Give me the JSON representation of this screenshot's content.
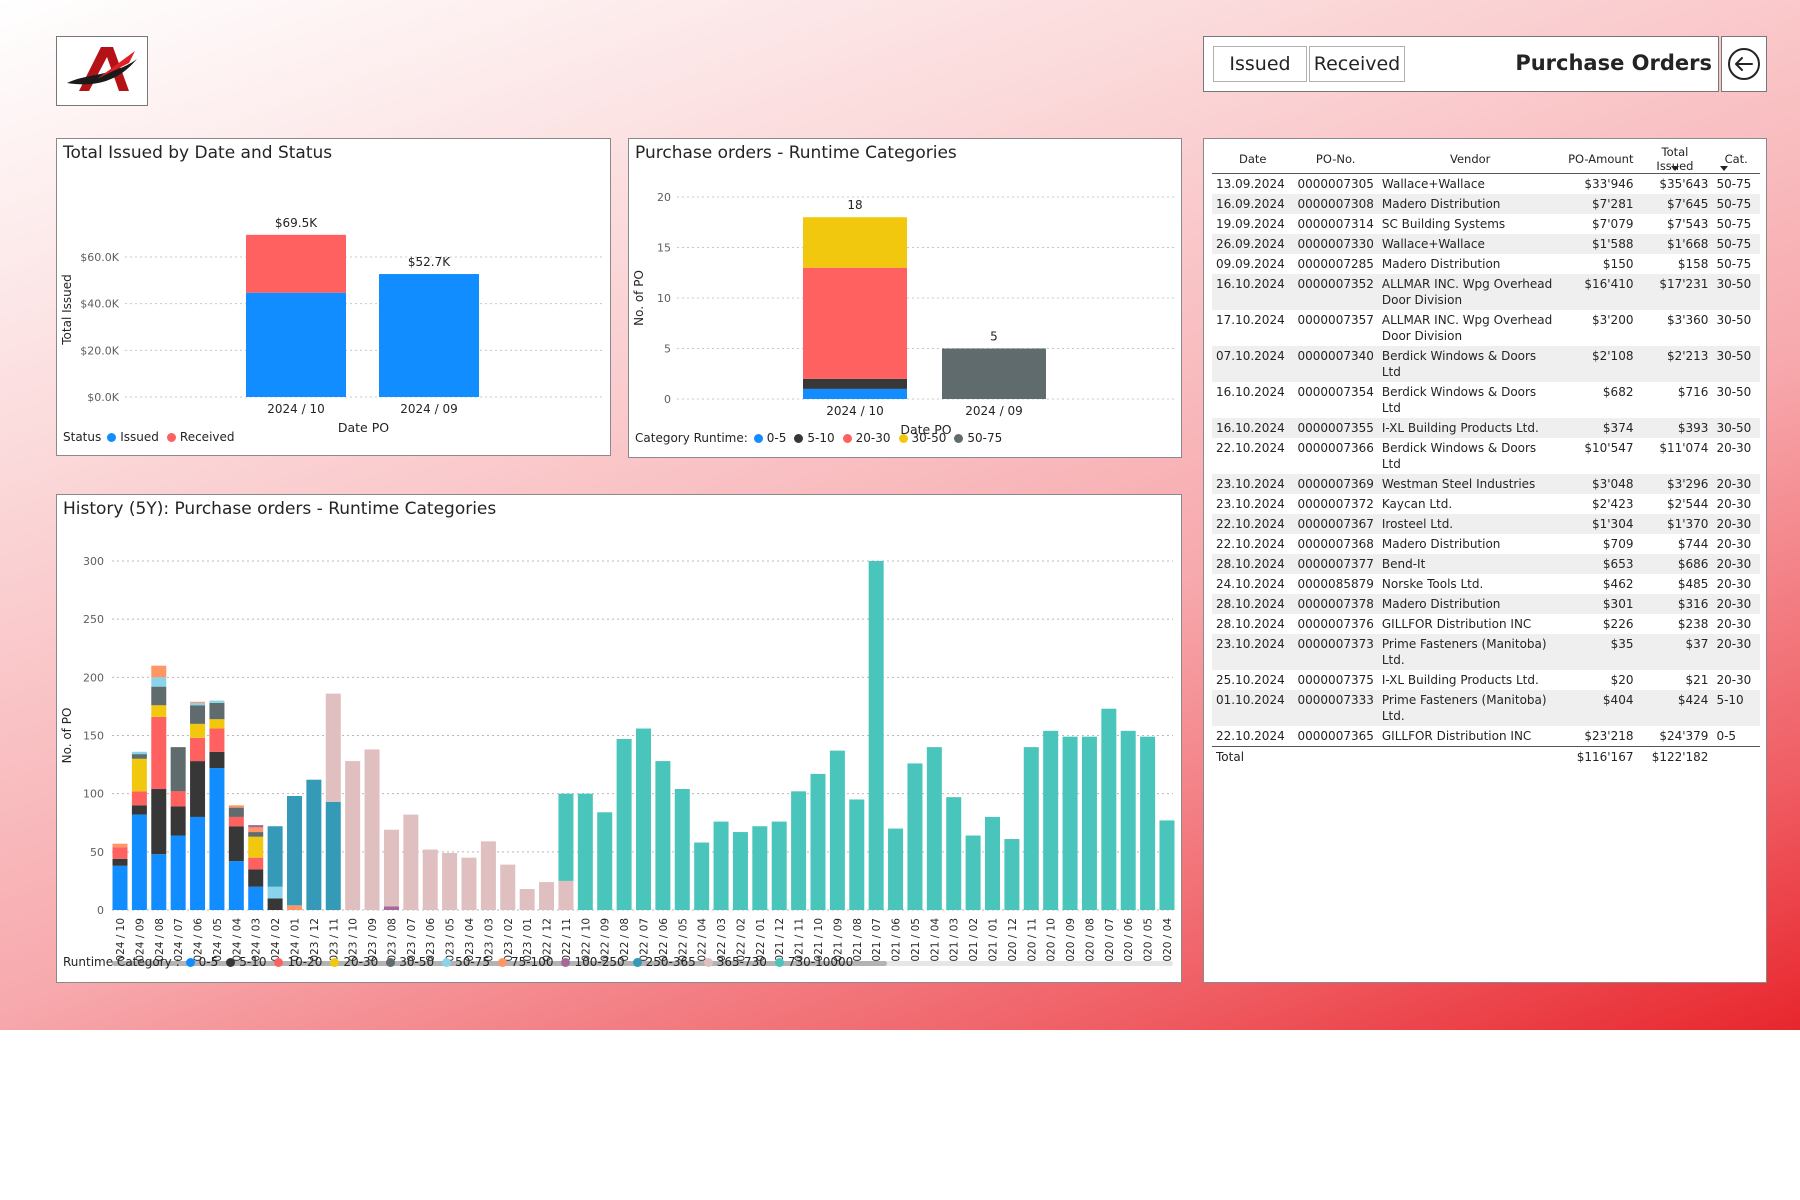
{
  "header": {
    "title": "Purchase Orders",
    "toggle_issued": "Issued",
    "toggle_received": "Received"
  },
  "chart_data": [
    {
      "id": "total-issued",
      "type": "bar",
      "title": "Total Issued by Date and Status",
      "xlabel": "Date PO",
      "ylabel": "Total Issued",
      "categories": [
        "2024 / 10",
        "2024 / 09"
      ],
      "yticks": [
        "$0.0K",
        "$20.0K",
        "$40.0K",
        "$60.0K"
      ],
      "ylim": [
        0,
        75000
      ],
      "series": [
        {
          "name": "Issued",
          "color": "#118DFF",
          "values": [
            44700,
            52700
          ]
        },
        {
          "name": "Received",
          "color": "#FF6060",
          "values": [
            24800,
            0
          ]
        }
      ],
      "totals": [
        "$69.5K",
        "$52.7K"
      ],
      "legend_title": "Status",
      "legend_position": "bottom-left"
    },
    {
      "id": "runtime-categories",
      "type": "bar",
      "title": "Purchase orders - Runtime Categories",
      "xlabel": "Date PO",
      "ylabel": "No. of PO",
      "categories": [
        "2024 / 10",
        "2024 / 09"
      ],
      "yticks": [
        0,
        5,
        10,
        15,
        20
      ],
      "ylim": [
        0,
        20
      ],
      "series": [
        {
          "name": "0-5",
          "color": "#118DFF",
          "values": [
            1,
            0
          ]
        },
        {
          "name": "5-10",
          "color": "#373737",
          "values": [
            1,
            0
          ]
        },
        {
          "name": "20-30",
          "color": "#FF6060",
          "values": [
            11,
            0
          ]
        },
        {
          "name": "30-50",
          "color": "#F2C80F",
          "values": [
            5,
            0
          ]
        },
        {
          "name": "50-75",
          "color": "#5F6B6D",
          "values": [
            0,
            5
          ]
        }
      ],
      "totals": [
        "18",
        "5"
      ],
      "legend_title": "Category Runtime:",
      "legend_position": "bottom-left"
    },
    {
      "id": "history",
      "type": "bar",
      "title": "History (5Y): Purchase orders - Runtime Categories",
      "ylabel": "No. of PO",
      "yticks": [
        0,
        50,
        100,
        150,
        200,
        250,
        300
      ],
      "ylim": [
        0,
        300
      ],
      "grid": true,
      "categories": [
        "2024 / 10",
        "2024 / 09",
        "2024 / 08",
        "2024 / 07",
        "2024 / 06",
        "2024 / 05",
        "2024 / 04",
        "2024 / 03",
        "2024 / 02",
        "2024 / 01",
        "2023 / 12",
        "2023 / 11",
        "2023 / 10",
        "2023 / 09",
        "2023 / 08",
        "2023 / 07",
        "2023 / 06",
        "2023 / 05",
        "2023 / 04",
        "2023 / 03",
        "2023 / 02",
        "2023 / 01",
        "2022 / 12",
        "2022 / 11",
        "2022 / 10",
        "2022 / 09",
        "2022 / 08",
        "2022 / 07",
        "2022 / 06",
        "2022 / 05",
        "2022 / 04",
        "2022 / 03",
        "2022 / 02",
        "2022 / 01",
        "2021 / 12",
        "2021 / 11",
        "2021 / 10",
        "2021 / 09",
        "2021 / 08",
        "2021 / 07",
        "2021 / 06",
        "2021 / 05",
        "2021 / 04",
        "2021 / 03",
        "2021 / 02",
        "2021 / 01",
        "2020 / 12",
        "2020 / 11",
        "2020 / 10",
        "2020 / 09",
        "2020 / 08",
        "2020 / 07",
        "2020 / 06",
        "2020 / 05",
        "2020 / 04"
      ],
      "series": [
        {
          "name": "0-5",
          "color": "#118DFF",
          "values": [
            38,
            82,
            48,
            64,
            80,
            122,
            42,
            20,
            0,
            0,
            0,
            0,
            0,
            0,
            0,
            0,
            0,
            0,
            0,
            0,
            0,
            0,
            0,
            0,
            0,
            0,
            0,
            0,
            0,
            0,
            0,
            0,
            0,
            0,
            0,
            0,
            0,
            0,
            0,
            0,
            0,
            0,
            0,
            0,
            0,
            0,
            0,
            0,
            0,
            0,
            0,
            0,
            0,
            0,
            0
          ]
        },
        {
          "name": "5-10",
          "color": "#373737",
          "values": [
            6,
            8,
            56,
            25,
            48,
            14,
            30,
            15,
            10,
            0,
            0,
            0,
            0,
            0,
            0,
            0,
            0,
            0,
            0,
            0,
            0,
            0,
            0,
            0,
            0,
            0,
            0,
            0,
            0,
            0,
            0,
            0,
            0,
            0,
            0,
            0,
            0,
            0,
            0,
            0,
            0,
            0,
            0,
            0,
            0,
            0,
            0,
            0,
            0,
            0,
            0,
            0,
            0,
            0,
            0
          ]
        },
        {
          "name": "10-20",
          "color": "#FF6060",
          "values": [
            10,
            12,
            62,
            13,
            20,
            20,
            8,
            10,
            0,
            0,
            0,
            0,
            0,
            0,
            0,
            0,
            0,
            0,
            0,
            0,
            0,
            0,
            0,
            0,
            0,
            0,
            0,
            0,
            0,
            0,
            0,
            0,
            0,
            0,
            0,
            0,
            0,
            0,
            0,
            0,
            0,
            0,
            0,
            0,
            0,
            0,
            0,
            0,
            0,
            0,
            0,
            0,
            0,
            0,
            0
          ]
        },
        {
          "name": "20-30",
          "color": "#F2C80F",
          "values": [
            0,
            28,
            10,
            0,
            12,
            8,
            0,
            18,
            0,
            0,
            0,
            0,
            0,
            0,
            0,
            0,
            0,
            0,
            0,
            0,
            0,
            0,
            0,
            0,
            0,
            0,
            0,
            0,
            0,
            0,
            0,
            0,
            0,
            0,
            0,
            0,
            0,
            0,
            0,
            0,
            0,
            0,
            0,
            0,
            0,
            0,
            0,
            0,
            0,
            0,
            0,
            0,
            0,
            0,
            0
          ]
        },
        {
          "name": "30-50",
          "color": "#5F6B6D",
          "values": [
            0,
            4,
            16,
            38,
            16,
            14,
            8,
            4,
            0,
            0,
            0,
            0,
            0,
            0,
            0,
            0,
            0,
            0,
            0,
            0,
            0,
            0,
            0,
            0,
            0,
            0,
            0,
            0,
            0,
            0,
            0,
            0,
            0,
            0,
            0,
            0,
            0,
            0,
            0,
            0,
            0,
            0,
            0,
            0,
            0,
            0,
            0,
            0,
            0,
            0,
            0,
            0,
            0,
            0,
            0
          ]
        },
        {
          "name": "50-75",
          "color": "#8AD4EB",
          "values": [
            0,
            2,
            8,
            0,
            2,
            2,
            0,
            0,
            10,
            0,
            0,
            0,
            0,
            0,
            0,
            0,
            0,
            0,
            0,
            0,
            0,
            0,
            0,
            0,
            0,
            0,
            0,
            0,
            0,
            0,
            0,
            0,
            0,
            0,
            0,
            0,
            0,
            0,
            0,
            0,
            0,
            0,
            0,
            0,
            0,
            0,
            0,
            0,
            0,
            0,
            0,
            0,
            0,
            0,
            0
          ]
        },
        {
          "name": "75-100",
          "color": "#FE9666",
          "values": [
            3,
            0,
            10,
            0,
            1,
            0,
            2,
            4,
            0,
            4,
            0,
            0,
            0,
            0,
            0,
            0,
            0,
            0,
            0,
            0,
            0,
            0,
            0,
            0,
            0,
            0,
            0,
            0,
            0,
            0,
            0,
            0,
            0,
            0,
            0,
            0,
            0,
            0,
            0,
            0,
            0,
            0,
            0,
            0,
            0,
            0,
            0,
            0,
            0,
            0,
            0,
            0,
            0,
            0,
            0
          ]
        },
        {
          "name": "100-250",
          "color": "#A66999",
          "values": [
            0,
            0,
            0,
            0,
            0,
            0,
            0,
            2,
            0,
            0,
            0,
            0,
            0,
            0,
            3,
            0,
            0,
            0,
            0,
            0,
            0,
            0,
            0,
            0,
            0,
            0,
            0,
            0,
            0,
            0,
            0,
            0,
            0,
            0,
            0,
            0,
            0,
            0,
            0,
            0,
            0,
            0,
            0,
            0,
            0,
            0,
            0,
            0,
            0,
            0,
            0,
            0,
            0,
            0,
            0
          ]
        },
        {
          "name": "250-365",
          "color": "#3599B8",
          "values": [
            0,
            0,
            0,
            0,
            0,
            0,
            0,
            0,
            52,
            94,
            112,
            93,
            0,
            0,
            0,
            0,
            0,
            0,
            0,
            0,
            0,
            0,
            0,
            0,
            0,
            0,
            0,
            0,
            0,
            0,
            0,
            0,
            0,
            0,
            0,
            0,
            0,
            0,
            0,
            0,
            0,
            0,
            0,
            0,
            0,
            0,
            0,
            0,
            0,
            0,
            0,
            0,
            0,
            0,
            0
          ]
        },
        {
          "name": "365-730",
          "color": "#DFBFBF",
          "values": [
            0,
            0,
            0,
            0,
            0,
            0,
            0,
            0,
            0,
            0,
            0,
            93,
            128,
            138,
            66,
            82,
            52,
            49,
            45,
            59,
            39,
            18,
            24,
            25,
            0,
            0,
            0,
            0,
            0,
            0,
            0,
            0,
            0,
            0,
            0,
            0,
            0,
            0,
            0,
            0,
            0,
            0,
            0,
            0,
            0,
            0,
            0,
            0,
            0,
            0,
            0,
            0,
            0,
            0,
            0
          ]
        },
        {
          "name": "730-10000",
          "color": "#4AC5BB",
          "values": [
            0,
            0,
            0,
            0,
            0,
            0,
            0,
            0,
            0,
            0,
            0,
            0,
            0,
            0,
            0,
            0,
            0,
            0,
            0,
            0,
            0,
            0,
            0,
            75,
            100,
            84,
            147,
            156,
            128,
            104,
            58,
            76,
            67,
            72,
            76,
            102,
            117,
            137,
            95,
            300,
            70,
            126,
            140,
            97,
            64,
            80,
            61,
            140,
            154,
            149,
            149,
            173,
            154,
            149,
            77
          ]
        }
      ],
      "legend_title": "Runtime Category :",
      "legend_position": "bottom-left"
    }
  ],
  "table": {
    "columns": [
      "Date",
      "PO-No.",
      "Vendor",
      "PO-Amount",
      "Total Issued",
      "Cat."
    ],
    "rows": [
      [
        "13.09.2024",
        "0000007305",
        "Wallace+Wallace",
        "$33'946",
        "$35'643",
        "50-75"
      ],
      [
        "16.09.2024",
        "0000007308",
        "Madero Distribution",
        "$7'281",
        "$7'645",
        "50-75"
      ],
      [
        "19.09.2024",
        "0000007314",
        "SC Building Systems",
        "$7'079",
        "$7'543",
        "50-75"
      ],
      [
        "26.09.2024",
        "0000007330",
        "Wallace+Wallace",
        "$1'588",
        "$1'668",
        "50-75"
      ],
      [
        "09.09.2024",
        "0000007285",
        "Madero Distribution",
        "$150",
        "$158",
        "50-75"
      ],
      [
        "16.10.2024",
        "0000007352",
        "ALLMAR INC. Wpg Overhead Door Division",
        "$16'410",
        "$17'231",
        "30-50"
      ],
      [
        "17.10.2024",
        "0000007357",
        "ALLMAR INC. Wpg Overhead Door Division",
        "$3'200",
        "$3'360",
        "30-50"
      ],
      [
        "07.10.2024",
        "0000007340",
        "Berdick Windows & Doors Ltd",
        "$2'108",
        "$2'213",
        "30-50"
      ],
      [
        "16.10.2024",
        "0000007354",
        "Berdick Windows & Doors Ltd",
        "$682",
        "$716",
        "30-50"
      ],
      [
        "16.10.2024",
        "0000007355",
        "I-XL Building Products Ltd.",
        "$374",
        "$393",
        "30-50"
      ],
      [
        "22.10.2024",
        "0000007366",
        "Berdick Windows & Doors Ltd",
        "$10'547",
        "$11'074",
        "20-30"
      ],
      [
        "23.10.2024",
        "0000007369",
        "Westman Steel Industries",
        "$3'048",
        "$3'296",
        "20-30"
      ],
      [
        "23.10.2024",
        "0000007372",
        "Kaycan Ltd.",
        "$2'423",
        "$2'544",
        "20-30"
      ],
      [
        "22.10.2024",
        "0000007367",
        "Irosteel Ltd.",
        "$1'304",
        "$1'370",
        "20-30"
      ],
      [
        "22.10.2024",
        "0000007368",
        "Madero Distribution",
        "$709",
        "$744",
        "20-30"
      ],
      [
        "28.10.2024",
        "0000007377",
        "Bend-It",
        "$653",
        "$686",
        "20-30"
      ],
      [
        "24.10.2024",
        "0000085879",
        "Norske Tools Ltd.",
        "$462",
        "$485",
        "20-30"
      ],
      [
        "28.10.2024",
        "0000007378",
        "Madero Distribution",
        "$301",
        "$316",
        "20-30"
      ],
      [
        "28.10.2024",
        "0000007376",
        "GILLFOR Distribution INC",
        "$226",
        "$238",
        "20-30"
      ],
      [
        "23.10.2024",
        "0000007373",
        "Prime Fasteners (Manitoba) Ltd.",
        "$35",
        "$37",
        "20-30"
      ],
      [
        "25.10.2024",
        "0000007375",
        "I-XL Building Products Ltd.",
        "$20",
        "$21",
        "20-30"
      ],
      [
        "01.10.2024",
        "0000007333",
        "Prime Fasteners (Manitoba) Ltd.",
        "$404",
        "$424",
        "5-10"
      ],
      [
        "22.10.2024",
        "0000007365",
        "GILLFOR Distribution INC",
        "$23'218",
        "$24'379",
        "0-5"
      ]
    ],
    "total": {
      "label": "Total",
      "po_amount": "$116'167",
      "total_issued": "$122'182"
    }
  },
  "icons": {
    "logo": "company-logo",
    "back": "back-arrow-icon",
    "sort": "sort-desc-icon"
  }
}
